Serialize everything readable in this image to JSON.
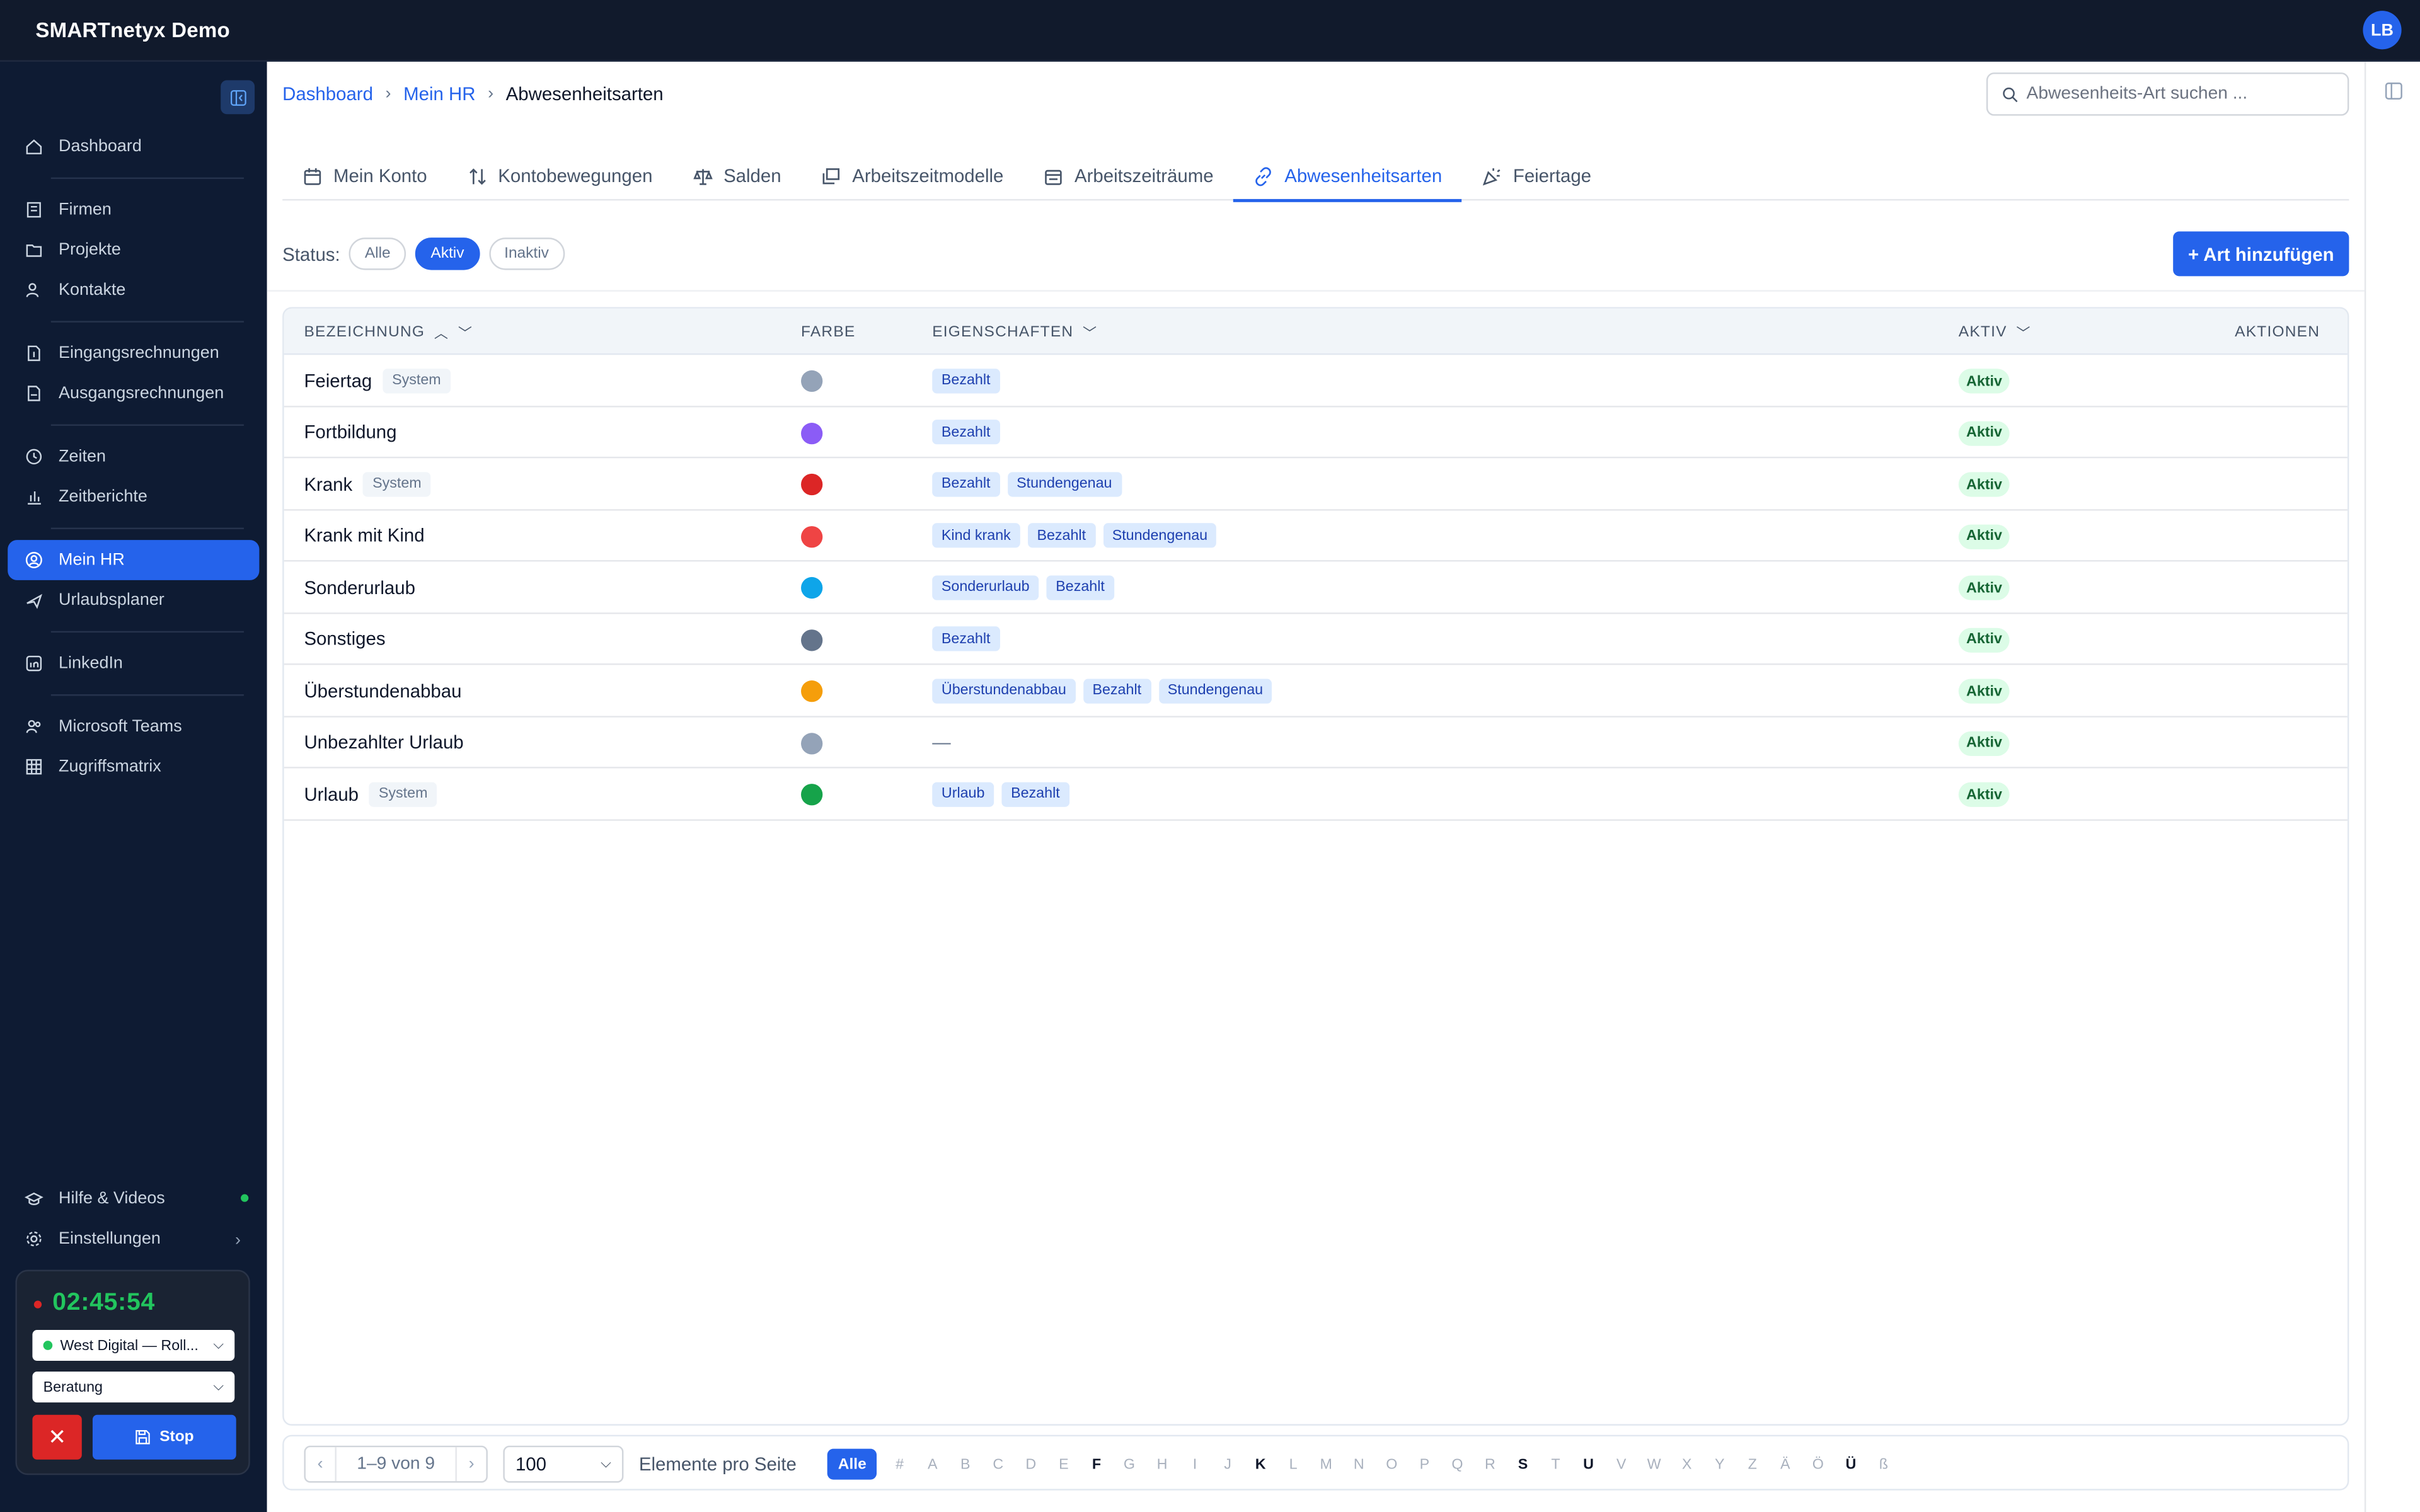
{
  "app": {
    "title": "SMARTnetyx Demo",
    "user_initials": "LB"
  },
  "sidebar": {
    "items": [
      {
        "label": "Dashboard",
        "icon": "home-icon"
      },
      {
        "label": "Firmen",
        "icon": "building-icon"
      },
      {
        "label": "Projekte",
        "icon": "folder-icon"
      },
      {
        "label": "Kontakte",
        "icon": "users-icon"
      },
      {
        "label": "Eingangsrechnungen",
        "icon": "file-in-icon"
      },
      {
        "label": "Ausgangsrechnungen",
        "icon": "file-out-icon"
      },
      {
        "label": "Zeiten",
        "icon": "clock-icon"
      },
      {
        "label": "Zeitberichte",
        "icon": "bar-chart-icon"
      },
      {
        "label": "Mein HR",
        "icon": "user-circle-icon",
        "active": true
      },
      {
        "label": "Urlaubsplaner",
        "icon": "plane-icon"
      },
      {
        "label": "LinkedIn",
        "icon": "linkedin-icon"
      },
      {
        "label": "Microsoft Teams",
        "icon": "teams-icon"
      },
      {
        "label": "Zugriffsmatrix",
        "icon": "grid-icon"
      }
    ],
    "bottom": [
      {
        "label": "Hilfe & Videos",
        "icon": "graduation-icon"
      },
      {
        "label": "Einstellungen",
        "icon": "gear-icon"
      }
    ],
    "timer": {
      "time": "02:45:54",
      "project": "West Digital — Roll...",
      "activity": "Beratung",
      "stop_label": "Stop",
      "cancel_label": "✕"
    }
  },
  "breadcrumb": [
    "Dashboard",
    "Mein HR",
    "Abwesenheitsarten"
  ],
  "search": {
    "placeholder": "Abwesenheits-Art suchen ..."
  },
  "tabs": [
    {
      "label": "Mein Konto",
      "icon": "calendar-icon"
    },
    {
      "label": "Kontobewegungen",
      "icon": "arrows-updown-icon"
    },
    {
      "label": "Salden",
      "icon": "scale-icon"
    },
    {
      "label": "Arbeitszeitmodelle",
      "icon": "layers-icon"
    },
    {
      "label": "Arbeitszeiträume",
      "icon": "calendar-range-icon"
    },
    {
      "label": "Abwesenheitsarten",
      "icon": "link-icon",
      "active": true
    },
    {
      "label": "Feiertage",
      "icon": "party-icon"
    }
  ],
  "filter": {
    "label": "Status:",
    "options": [
      "Alle",
      "Aktiv",
      "Inaktiv"
    ],
    "selected": "Aktiv"
  },
  "add_button": "+ Art hinzufügen",
  "table": {
    "columns": {
      "name": "BEZEICHNUNG",
      "color": "FARBE",
      "props": "EIGENSCHAFTEN",
      "active": "AKTIV",
      "actions": "AKTIONEN"
    },
    "rows": [
      {
        "name": "Feiertag",
        "system": "System",
        "color": "#94a3b8",
        "props": [
          "Bezahlt"
        ],
        "active": "Aktiv"
      },
      {
        "name": "Fortbildung",
        "system": "",
        "color": "#8b5cf6",
        "props": [
          "Bezahlt"
        ],
        "active": "Aktiv"
      },
      {
        "name": "Krank",
        "system": "System",
        "color": "#dc2626",
        "props": [
          "Bezahlt",
          "Stundengenau"
        ],
        "active": "Aktiv"
      },
      {
        "name": "Krank mit Kind",
        "system": "",
        "color": "#ef4444",
        "props": [
          "Kind krank",
          "Bezahlt",
          "Stundengenau"
        ],
        "active": "Aktiv"
      },
      {
        "name": "Sonderurlaub",
        "system": "",
        "color": "#0ea5e9",
        "props": [
          "Sonderurlaub",
          "Bezahlt"
        ],
        "active": "Aktiv"
      },
      {
        "name": "Sonstiges",
        "system": "",
        "color": "#64748b",
        "props": [
          "Bezahlt"
        ],
        "active": "Aktiv"
      },
      {
        "name": "Überstundenabbau",
        "system": "",
        "color": "#f59e0b",
        "props": [
          "Überstundenabbau",
          "Bezahlt",
          "Stundengenau"
        ],
        "active": "Aktiv"
      },
      {
        "name": "Unbezahlter Urlaub",
        "system": "",
        "color": "#94a3b8",
        "props": [],
        "empty": "—",
        "active": "Aktiv"
      },
      {
        "name": "Urlaub",
        "system": "System",
        "color": "#16a34a",
        "props": [
          "Urlaub",
          "Bezahlt"
        ],
        "active": "Aktiv"
      }
    ]
  },
  "footer": {
    "range": "1–9 von 9",
    "per_page": "100",
    "per_page_label": "Elemente pro Seite",
    "alpha_all": "Alle",
    "letters": [
      "#",
      "A",
      "B",
      "C",
      "D",
      "E",
      "F",
      "G",
      "H",
      "I",
      "J",
      "K",
      "L",
      "M",
      "N",
      "O",
      "P",
      "Q",
      "R",
      "S",
      "T",
      "U",
      "V",
      "W",
      "X",
      "Y",
      "Z",
      "Ä",
      "Ö",
      "Ü",
      "ß"
    ],
    "letters_with_entries": [
      "F",
      "K",
      "S",
      "U",
      "Ü"
    ]
  }
}
